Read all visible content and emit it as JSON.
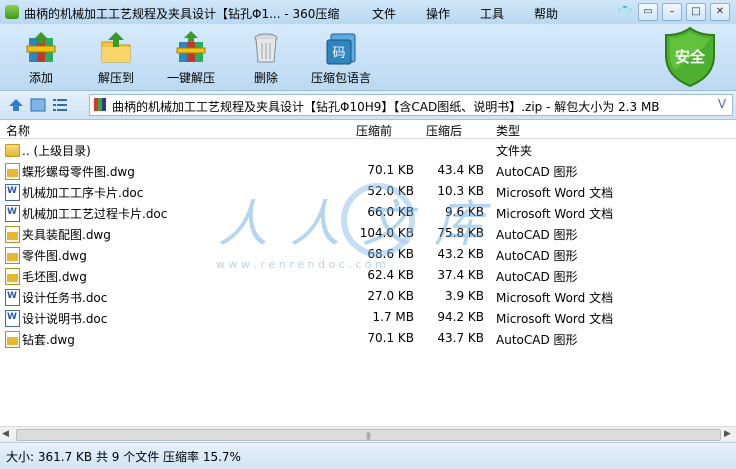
{
  "window": {
    "title": "曲柄的机械加工工艺规程及夹具设计【钻孔Φ1... - 360压缩",
    "menu": [
      "文件",
      "操作",
      "工具",
      "帮助"
    ]
  },
  "toolbar": {
    "add": "添加",
    "extract_to": "解压到",
    "one_click_extract": "一键解压",
    "delete": "删除",
    "archive_language": "压缩包语言"
  },
  "badge": {
    "security": "安全"
  },
  "address": {
    "path": "曲柄的机械加工工艺规程及夹具设计【钻孔Φ10H9】【含CAD图纸、说明书】.zip - 解包大小为 2.3 MB"
  },
  "list": {
    "columns": {
      "name": "名称",
      "size": "压缩前",
      "packed": "压缩后",
      "type": "类型"
    },
    "rows": [
      {
        "icon": "folder-icon",
        "name": ".. (上级目录)",
        "size": "",
        "packed": "",
        "type": "文件夹"
      },
      {
        "icon": "dwg-file-icon",
        "name": "蝶形螺母零件图.dwg",
        "size": "70.1 KB",
        "packed": "43.4 KB",
        "type": "AutoCAD 图形"
      },
      {
        "icon": "word-file-icon",
        "name": "机械加工工序卡片.doc",
        "size": "52.0 KB",
        "packed": "10.3 KB",
        "type": "Microsoft Word 文档"
      },
      {
        "icon": "word-file-icon",
        "name": "机械加工工艺过程卡片.doc",
        "size": "66.0 KB",
        "packed": "9.6 KB",
        "type": "Microsoft Word 文档"
      },
      {
        "icon": "dwg-file-icon",
        "name": "夹具装配图.dwg",
        "size": "104.0 KB",
        "packed": "75.8 KB",
        "type": "AutoCAD 图形"
      },
      {
        "icon": "dwg-file-icon",
        "name": "零件图.dwg",
        "size": "68.6 KB",
        "packed": "43.2 KB",
        "type": "AutoCAD 图形"
      },
      {
        "icon": "dwg-file-icon",
        "name": "毛坯图.dwg",
        "size": "62.4 KB",
        "packed": "37.4 KB",
        "type": "AutoCAD 图形"
      },
      {
        "icon": "word-file-icon",
        "name": "设计任务书.doc",
        "size": "27.0 KB",
        "packed": "3.9 KB",
        "type": "Microsoft Word 文档"
      },
      {
        "icon": "word-file-icon",
        "name": "设计说明书.doc",
        "size": "1.7 MB",
        "packed": "94.2 KB",
        "type": "Microsoft Word 文档"
      },
      {
        "icon": "dwg-file-icon",
        "name": "钻套.dwg",
        "size": "70.1 KB",
        "packed": "43.7 KB",
        "type": "AutoCAD 图形"
      }
    ]
  },
  "watermark": {
    "text": "人人文库",
    "url": "w w w . r e n r e n d o c . c o m"
  },
  "status": {
    "text": "大小: 361.7 KB 共 9 个文件 压缩率 15.7%"
  },
  "colors": {
    "shield": "#4caf2f",
    "toolbar_bg": "#c9e1f6"
  }
}
